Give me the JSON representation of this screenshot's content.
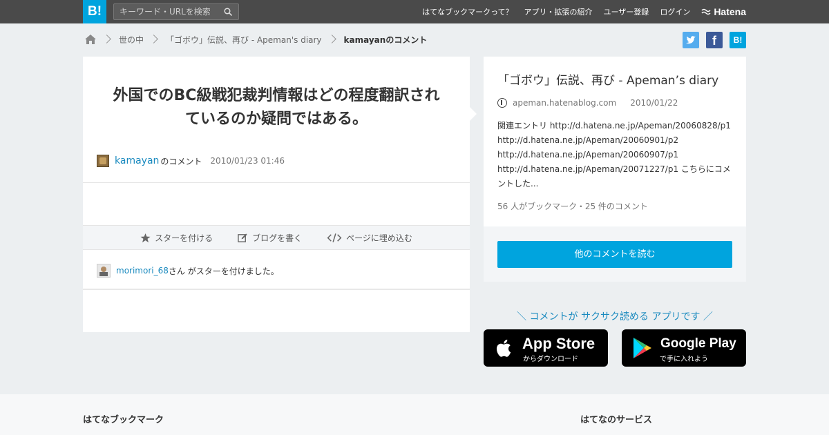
{
  "header": {
    "logo": "B!",
    "search_placeholder": "キーワード・URLを検索",
    "nav": [
      "はてなブックマークって？",
      "アプリ・拡張の紹介",
      "ユーザー登録",
      "ログイン"
    ],
    "brand": "Hatena"
  },
  "breadcrumb": {
    "items": [
      "世の中",
      "「ゴボウ」伝説、再び - Apeman's diary"
    ],
    "current": "kamayanのコメント"
  },
  "share": {
    "facebook": "f",
    "hatena": "B!"
  },
  "comment": {
    "text_line1": "外国でのBC級戦犯裁判情報はどの程度翻訳され",
    "text_line2": "ているのか疑問ではある。",
    "user": "kamayan",
    "suffix": "のコメント",
    "timestamp": "2010/01/23 01:46"
  },
  "actions": {
    "star": "スターを付ける",
    "blog": "ブログを書く",
    "embed": "ページに埋め込む"
  },
  "star": {
    "user": "morimori_68",
    "text": "さん がスターを付けました。"
  },
  "entry": {
    "title": "「ゴボウ」伝説、再び - Apeman’s diary",
    "domain": "apeman.hatenablog.com",
    "date": "2010/01/22",
    "excerpt_lines": [
      "関連エントリ http://d.hatena.ne.jp/Apeman/20060828/p1",
      "http://d.hatena.ne.jp/Apeman/20060901/p2",
      "http://d.hatena.ne.jp/Apeman/20060907/p1",
      "http://d.hatena.ne.jp/Apeman/20071227/p1 こちらにコメ",
      "ントした..."
    ],
    "stats": "56 人がブックマーク・25 件のコメント"
  },
  "more_button": "他のコメントを読む",
  "app_promo": "＼ コメントが サクサク読める アプリです ／",
  "stores": {
    "apple_big": "App Store",
    "apple_small": "からダウンロード",
    "google_big": "Google Play",
    "google_small": "で手に入れよう"
  },
  "footer": {
    "left_title": "はてなブックマーク",
    "right_title": "はてなのサービス"
  },
  "colors": {
    "accent": "#00a4de",
    "topbar": "#4a4a4a",
    "link": "#1a8abf",
    "background": "#eceff1"
  }
}
